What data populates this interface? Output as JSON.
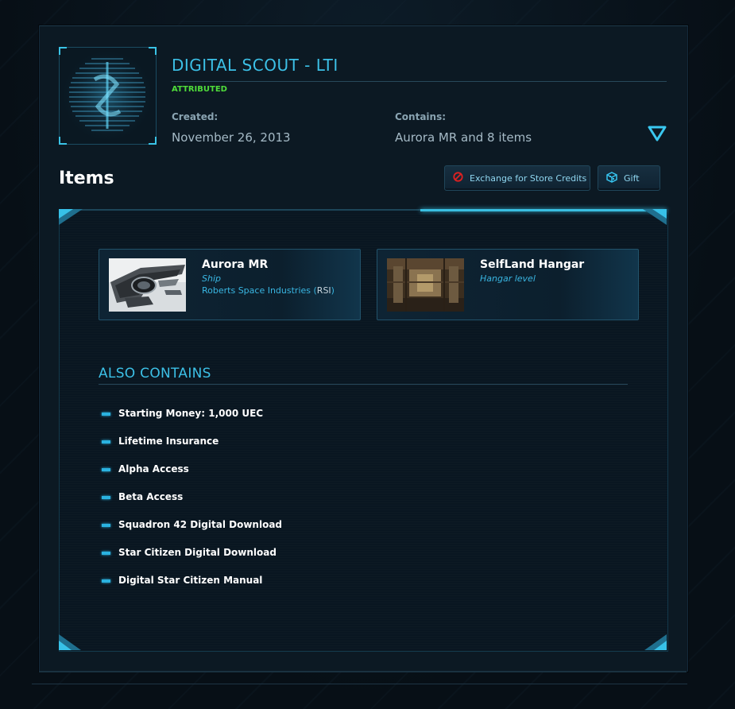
{
  "pledge": {
    "title": "DIGITAL SCOUT - LTI",
    "status": "ATTRIBUTED",
    "created_label": "Created:",
    "created_value": "November 26, 2013",
    "contains_label": "Contains:",
    "contains_value": "Aurora MR and 8 items",
    "thumbnail_icon": "rsi-emblem-icon"
  },
  "items_section": {
    "heading": "Items",
    "exchange_button": "Exchange for Store Credits",
    "exchange_icon": "block-icon",
    "gift_button": "Gift",
    "gift_icon": "gift-box-icon"
  },
  "items": [
    {
      "name": "Aurora MR",
      "kind": "Ship",
      "maker": "Roberts Space Industries (",
      "maker_abbr": "RSI",
      "maker_close": ")"
    },
    {
      "name": "SelfLand Hangar",
      "kind": "Hangar level"
    }
  ],
  "also_contains": {
    "title": "ALSO CONTAINS",
    "entries": [
      "Starting Money: 1,000 UEC",
      "Lifetime Insurance",
      "Alpha Access",
      "Beta Access",
      "Squadron 42 Digital Download",
      "Star Citizen Digital Download",
      "Digital Star Citizen Manual"
    ]
  },
  "colors": {
    "accent": "#3cc0e6",
    "attributed": "#4fdc3a",
    "background": "#0c1923"
  }
}
